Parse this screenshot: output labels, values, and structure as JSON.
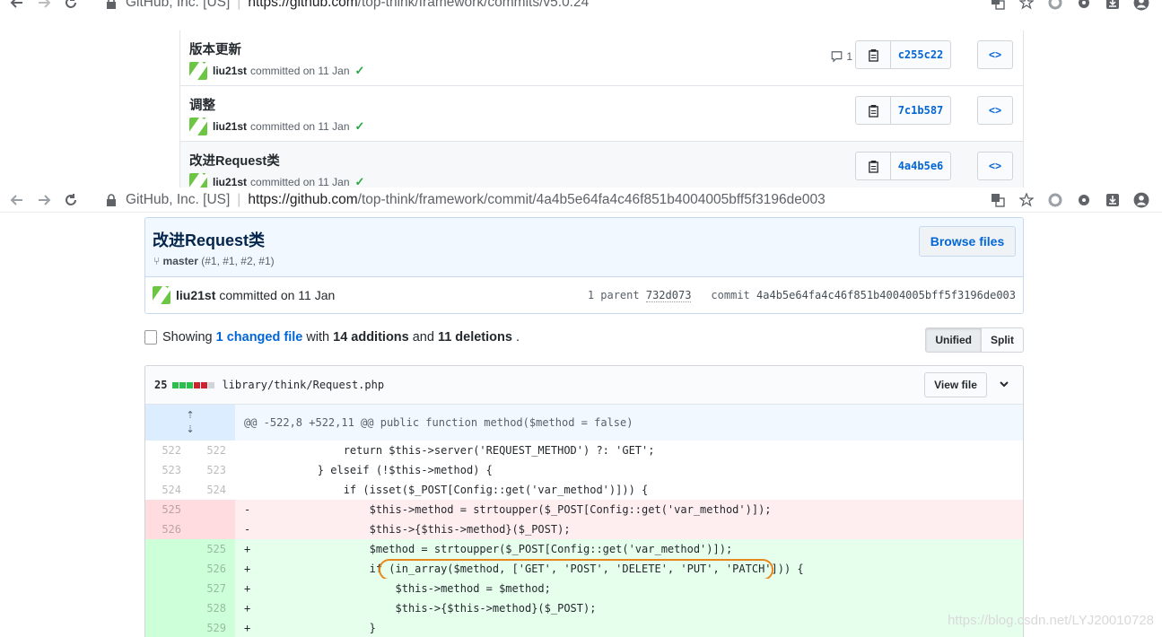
{
  "browser_top": {
    "site": "GitHub, Inc. [US]",
    "host": "https://github.com",
    "path": "/top-think/framework/commits/v5.0.24"
  },
  "browser_bottom": {
    "site": "GitHub, Inc. [US]",
    "host": "https://github.com",
    "path": "/top-think/framework/commit/4a4b5e64fa4c46f851b4004005bff5f3196de003"
  },
  "commits": [
    {
      "title": "版本更新",
      "author": "liu21st",
      "meta": "committed on 11 Jan",
      "comments": "1",
      "sha": "c255c22"
    },
    {
      "title": "调整",
      "author": "liu21st",
      "meta": "committed on 11 Jan",
      "comments": "",
      "sha": "7c1b587"
    },
    {
      "title": "改进Request类",
      "author": "liu21st",
      "meta": "committed on 11 Jan",
      "comments": "",
      "sha": "4a4b5e6"
    }
  ],
  "commit_detail": {
    "title": "改进Request类",
    "branch": "master",
    "refs": "(#1, #1, #2, #1)",
    "browse_files": "Browse files",
    "author": "liu21st",
    "committed": "committed on 11 Jan",
    "parent_label": "1 parent",
    "parent_sha": "732d073",
    "commit_label": "commit",
    "commit_sha": "4a4b5e64fa4c46f851b4004005bff5f3196de003"
  },
  "toc": {
    "showing": "Showing",
    "changed": "1 changed file",
    "with": "with",
    "additions": "14 additions",
    "and": "and",
    "deletions": "11 deletions",
    "period": ".",
    "unified": "Unified",
    "split": "Split"
  },
  "file": {
    "count": "25",
    "name": "library/think/Request.php",
    "view_file": "View file",
    "hunk": "@@ -522,8 +522,11 @@ public function method($method = false)",
    "lines": [
      {
        "type": "ctx",
        "old": "522",
        "new": "522",
        "sign": "",
        "code": "            return $this->server('REQUEST_METHOD') ?: 'GET';"
      },
      {
        "type": "ctx",
        "old": "523",
        "new": "523",
        "sign": "",
        "code": "        } elseif (!$this->method) {"
      },
      {
        "type": "ctx",
        "old": "524",
        "new": "524",
        "sign": "",
        "code": "            if (isset($_POST[Config::get('var_method')])) {"
      },
      {
        "type": "del",
        "old": "525",
        "new": "",
        "sign": "-",
        "code": "                $this->method = strtoupper($_POST[Config::get('var_method')]);"
      },
      {
        "type": "del",
        "old": "526",
        "new": "",
        "sign": "-",
        "code": "                $this->{$this->method}($_POST);"
      },
      {
        "type": "add",
        "old": "",
        "new": "525",
        "sign": "+",
        "code": "                $method = strtoupper($_POST[Config::get('var_method')]);"
      },
      {
        "type": "add",
        "old": "",
        "new": "526",
        "sign": "+",
        "code": "                if (in_array($method, ['GET', 'POST', 'DELETE', 'PUT', 'PATCH'])) {"
      },
      {
        "type": "add",
        "old": "",
        "new": "527",
        "sign": "+",
        "code": "                    $this->method = $method;"
      },
      {
        "type": "add",
        "old": "",
        "new": "528",
        "sign": "+",
        "code": "                    $this->{$this->method}($_POST);"
      },
      {
        "type": "add",
        "old": "",
        "new": "529",
        "sign": "+",
        "code": "                }"
      }
    ]
  },
  "watermark": "https://blog.csdn.net/LYJ20010728",
  "colors": {
    "add": "#2cbe4e",
    "del": "#cb2431",
    "neutral": "#d1d5da",
    "highlight": "#e8881a"
  }
}
